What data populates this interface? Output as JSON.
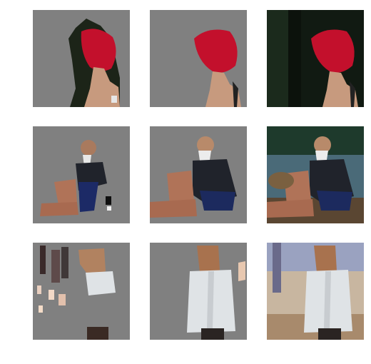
{
  "grid": {
    "rows": 3,
    "columns": 3,
    "column_kinds": [
      "noisy-segmentation-mask",
      "clean-segmentation-mask",
      "original-photo"
    ],
    "row_subjects": [
      "red-haired-woman-profile",
      "seated-old-man-bald-white-beard",
      "woman-in-white-coat-street"
    ],
    "colors": {
      "mask_background": "#808080",
      "page_background": "#ffffff",
      "red_hair": "#c3102c",
      "skin": "#c79a7e",
      "dark_jacket": "#20232b",
      "white_coat": "#dfe3e6",
      "forest_dark": "#111a12",
      "street_blur": "#b49a7e"
    }
  }
}
